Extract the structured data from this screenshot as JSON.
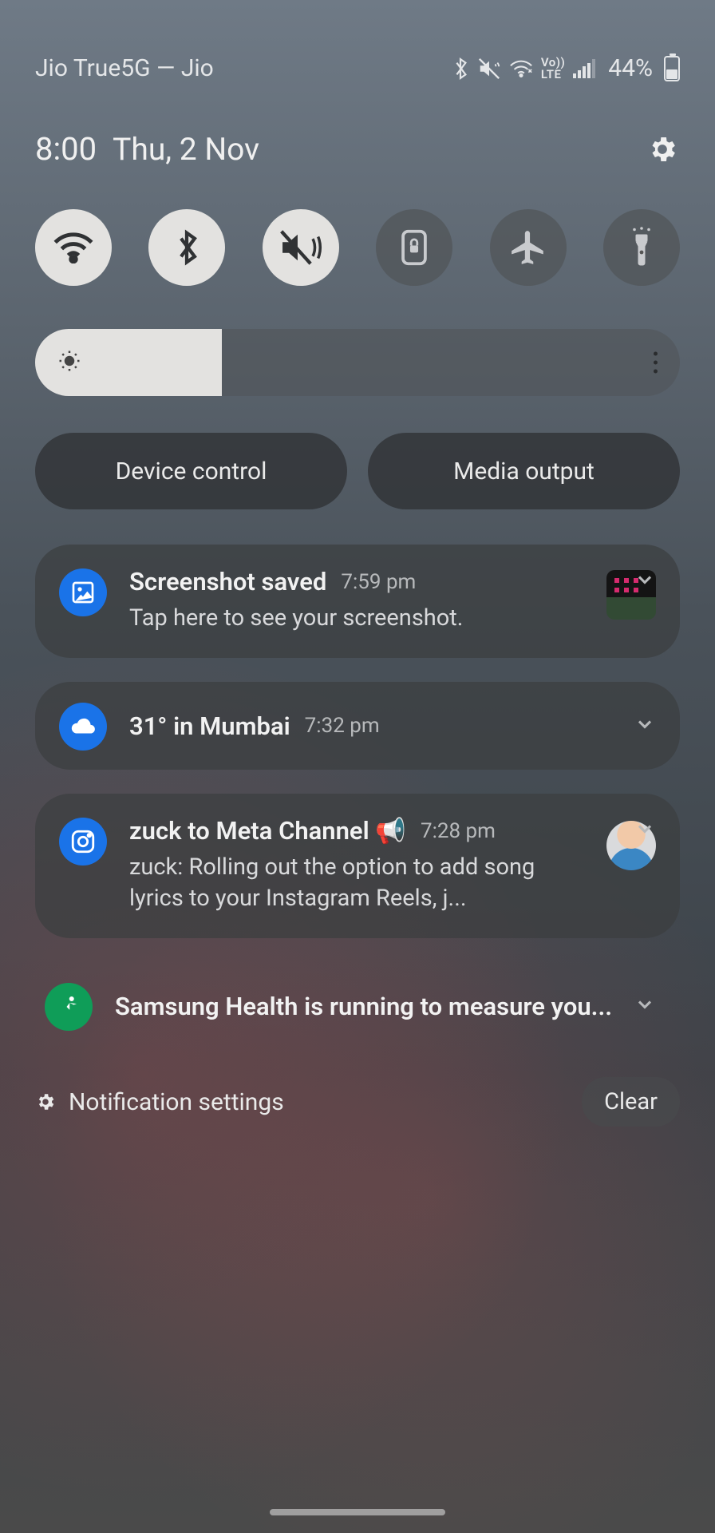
{
  "status_bar": {
    "carrier": "Jio True5G — Jio",
    "battery_pct": "44%",
    "battery_level": 0.44
  },
  "clock": {
    "time": "8:00",
    "date": "Thu, 2 Nov"
  },
  "quick_toggles": [
    {
      "name": "wifi",
      "active": true
    },
    {
      "name": "bluetooth",
      "active": true
    },
    {
      "name": "mute-vibrate",
      "active": true
    },
    {
      "name": "rotation-lock",
      "active": false
    },
    {
      "name": "airplane-mode",
      "active": false
    },
    {
      "name": "flashlight",
      "active": false
    }
  ],
  "brightness": {
    "level": 0.29
  },
  "panel_buttons": {
    "device_control": "Device control",
    "media_output": "Media output"
  },
  "notifications": [
    {
      "app": "gallery",
      "badge_color": "#1a73e8",
      "title": "Screenshot saved",
      "time": "7:59 pm",
      "text": "Tap here to see your screenshot.",
      "has_thumbnail": true
    },
    {
      "app": "weather",
      "badge_color": "#1a73e8",
      "title": "31° in Mumbai",
      "time": "7:32 pm"
    },
    {
      "app": "instagram",
      "badge_color": "#1a73e8",
      "title": "zuck to Meta Channel 📢",
      "time": "7:28 pm",
      "text": "zuck: Rolling out the option to add song lyrics to your Instagram Reels, j...",
      "has_avatar": true
    },
    {
      "app": "samsung-health",
      "badge_color": "#0f9d58",
      "title": "Samsung Health is running to measure you..."
    }
  ],
  "footer": {
    "settings_label": "Notification settings",
    "clear_label": "Clear"
  }
}
